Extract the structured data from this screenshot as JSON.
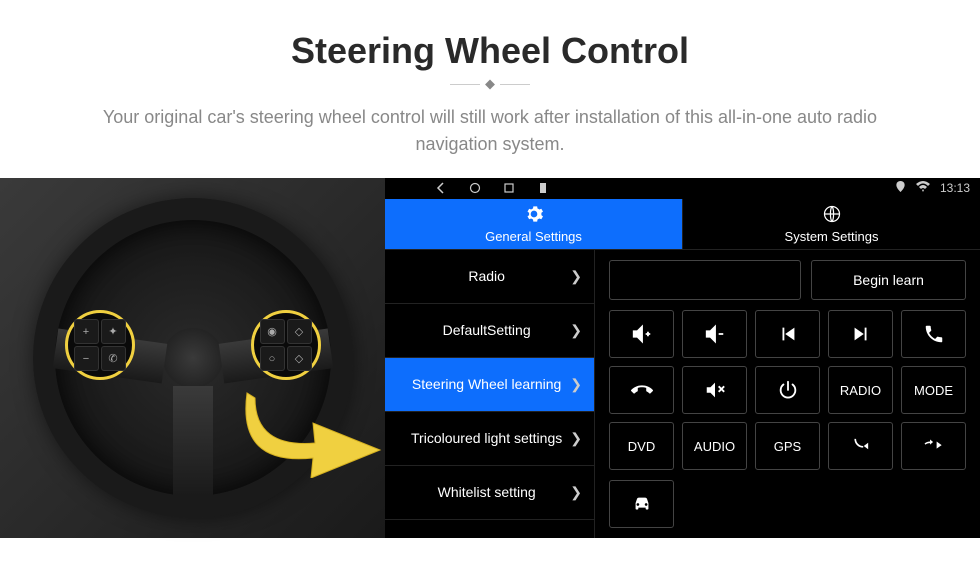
{
  "header": {
    "title": "Steering Wheel Control",
    "subtitle": "Your original car's steering wheel control will still work after installation of this all-in-one auto radio navigation system."
  },
  "status_bar": {
    "time": "13:13"
  },
  "tabs": {
    "general": "General Settings",
    "system": "System Settings"
  },
  "menu": [
    {
      "label": "Radio",
      "selected": false
    },
    {
      "label": "DefaultSetting",
      "selected": false
    },
    {
      "label": "Steering Wheel learning",
      "selected": true
    },
    {
      "label": "Tricoloured light settings",
      "selected": false
    },
    {
      "label": "Whitelist setting",
      "selected": false
    }
  ],
  "actions": {
    "begin_learn": "Begin learn"
  },
  "buttons": {
    "vol_up": "volume-up-icon",
    "vol_down": "volume-down-icon",
    "prev": "previous-track-icon",
    "next": "next-track-icon",
    "call": "phone-icon",
    "hangup": "hangup-icon",
    "mute": "mute-icon",
    "power": "power-icon",
    "radio": "RADIO",
    "mode": "MODE",
    "dvd": "DVD",
    "audio": "AUDIO",
    "gps": "GPS",
    "call_prev": "call-previous-icon",
    "call_next": "call-next-icon",
    "car": "car-icon"
  },
  "colors": {
    "accent": "#0d6efd",
    "highlight": "#f0d040"
  }
}
